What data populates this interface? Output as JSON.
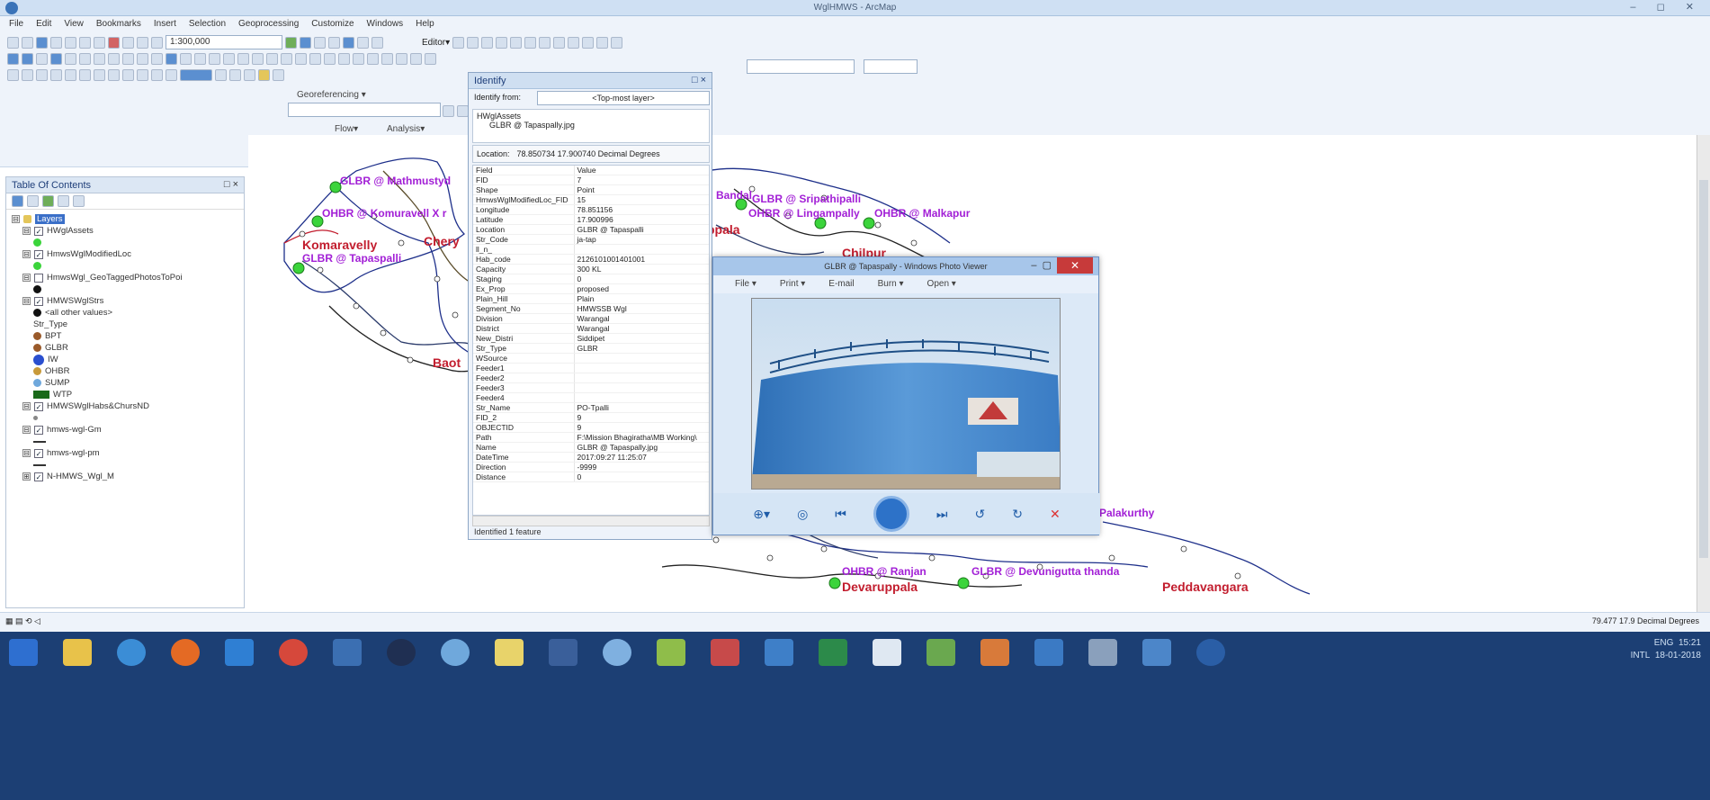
{
  "window": {
    "title": "WglHMWS - ArcMap",
    "controls": "– ◻ ✕"
  },
  "menu": [
    "File",
    "Edit",
    "View",
    "Bookmarks",
    "Insert",
    "Selection",
    "Geoprocessing",
    "Customize",
    "Windows",
    "Help"
  ],
  "toolbar": {
    "scale": "1:300,000",
    "editor_label": "Editor▾",
    "georef_label": "Georeferencing ▾",
    "flow_label": "Flow▾",
    "analysis_label": "Analysis▾"
  },
  "toc": {
    "title": "Table Of Contents",
    "close": "□ ×",
    "items": [
      {
        "label": "Layers",
        "level": 0,
        "checked": null,
        "expander": "⊟"
      },
      {
        "label": "HWglAssets",
        "level": 1,
        "checked": true,
        "expander": "⊟"
      },
      {
        "label": "",
        "level": 2,
        "symbol": "green"
      },
      {
        "label": "HmwsWglModifiedLoc",
        "level": 1,
        "checked": true,
        "expander": "⊟"
      },
      {
        "label": "",
        "level": 2,
        "symbol": "green"
      },
      {
        "label": "HmwsWgl_GeoTaggedPhotosToPoi",
        "level": 1,
        "checked": false,
        "expander": "⊟"
      },
      {
        "label": "",
        "level": 2,
        "symbol": "black"
      },
      {
        "label": "HMWSWglStrs",
        "level": 1,
        "checked": true,
        "expander": "⊟"
      },
      {
        "label": "<all other values>",
        "level": 2,
        "symbol": "black"
      },
      {
        "label": "Str_Type",
        "level": 2
      },
      {
        "label": "BPT",
        "level": 2,
        "symbol": "brown"
      },
      {
        "label": "GLBR",
        "level": 2,
        "symbol": "brown"
      },
      {
        "label": "IW",
        "level": 2,
        "symbol": "blue"
      },
      {
        "label": "OHBR",
        "level": 2,
        "symbol": "ohbr"
      },
      {
        "label": "SUMP",
        "level": 2,
        "symbol": "sump"
      },
      {
        "label": "WTP",
        "level": 2,
        "symbol": "wtp"
      },
      {
        "label": "HMWSWglHabs&ChursND",
        "level": 1,
        "checked": true,
        "expander": "⊟"
      },
      {
        "label": "",
        "level": 2,
        "symbol": "small"
      },
      {
        "label": "hmws-wgl-Gm",
        "level": 1,
        "checked": true,
        "expander": "⊟"
      },
      {
        "label": "",
        "level": 2,
        "symbol": "line"
      },
      {
        "label": "hmws-wgl-pm",
        "level": 1,
        "checked": true,
        "expander": "⊟"
      },
      {
        "label": "",
        "level": 2,
        "symbol": "line"
      },
      {
        "label": "N-HMWS_Wgl_M",
        "level": 1,
        "checked": true,
        "expander": "⊞"
      }
    ]
  },
  "identify": {
    "title": "Identify",
    "close": "□ ×",
    "from_label": "Identify from:",
    "from_value": "<Top-most layer>",
    "tree_layer": "HWglAssets",
    "tree_feature": "GLBR @ Tapaspally.jpg",
    "location_label": "Location:",
    "location_value": "78.850734  17.900740 Decimal Degrees",
    "col_field": "Field",
    "col_value": "Value",
    "rows": [
      [
        "FID",
        "7"
      ],
      [
        "Shape",
        "Point"
      ],
      [
        "HmwsWglModifiedLoc_FID",
        "15"
      ],
      [
        "Longitude",
        "78.851156"
      ],
      [
        "Latitude",
        "17.900996"
      ],
      [
        "Location",
        "GLBR @ Tapaspalli"
      ],
      [
        "Str_Code",
        "ja-tap"
      ],
      [
        "ll_n_",
        ""
      ],
      [
        "Hab_code",
        "2126101001401001"
      ],
      [
        "Capacity",
        "300 KL"
      ],
      [
        "Staging",
        "0"
      ],
      [
        "Ex_Prop",
        "proposed"
      ],
      [
        "Plain_Hill",
        "Plain"
      ],
      [
        "Segment_No",
        "HMWSSB Wgl"
      ],
      [
        "Division",
        "Warangal"
      ],
      [
        "District",
        "Warangal"
      ],
      [
        "New_Distri",
        "Siddipet"
      ],
      [
        "Str_Type",
        "GLBR"
      ],
      [
        "WSource",
        ""
      ],
      [
        "Feeder1",
        ""
      ],
      [
        "Feeder2",
        ""
      ],
      [
        "Feeder3",
        ""
      ],
      [
        "Feeder4",
        ""
      ],
      [
        "Str_Name",
        "PO-Tpalli"
      ],
      [
        "FID_2",
        "9"
      ],
      [
        "OBJECTID",
        "9"
      ],
      [
        "Path",
        "F:\\Mission Bhagiratha\\MB Working\\"
      ],
      [
        "Name",
        "GLBR @ Tapaspally.jpg"
      ],
      [
        "DateTime",
        "2017:09:27 11:25:07"
      ],
      [
        "Direction",
        "-9999"
      ],
      [
        "Distance",
        "0"
      ]
    ],
    "footer": "Identified 1 feature"
  },
  "viewer": {
    "title": "GLBR @ Tapaspally - Windows Photo Viewer",
    "menu": [
      "File ▾",
      "Print ▾",
      "E-mail",
      "Burn ▾",
      "Open ▾"
    ]
  },
  "map_labels": [
    {
      "text": "GLBR @ Mathmustyd",
      "cls": "purple"
    },
    {
      "text": "OHBR @ Komuravell X r",
      "cls": "purple"
    },
    {
      "text": "Komaravelly",
      "cls": "red"
    },
    {
      "text": "Chery",
      "cls": "red"
    },
    {
      "text": "GLBR @ Tapaspalli",
      "cls": "purple"
    },
    {
      "text": "Baot",
      "cls": "red"
    },
    {
      "text": "Bandal",
      "cls": "purple"
    },
    {
      "text": "GLBR @ Sripathipalli",
      "cls": "purple"
    },
    {
      "text": "OHBR @ Lingampally",
      "cls": "purple"
    },
    {
      "text": "OHBR @ Malkapur",
      "cls": "purple"
    },
    {
      "text": "ppala",
      "cls": "red"
    },
    {
      "text": "Chilpur",
      "cls": "red"
    },
    {
      "text": "Palakurthy",
      "cls": "purple"
    },
    {
      "text": "OHBR @ Ranjan",
      "cls": "purple"
    },
    {
      "text": "GLBR @ Devunigutta thanda",
      "cls": "purple"
    },
    {
      "text": "Devaruppala",
      "cls": "red"
    },
    {
      "text": "Peddavangara",
      "cls": "red"
    }
  ],
  "status": {
    "coords": "79.477  17.9 Decimal Degrees"
  },
  "clock": {
    "lang": "ENG",
    "kb": "INTL",
    "time": "15:21",
    "date": "18-01-2018"
  }
}
